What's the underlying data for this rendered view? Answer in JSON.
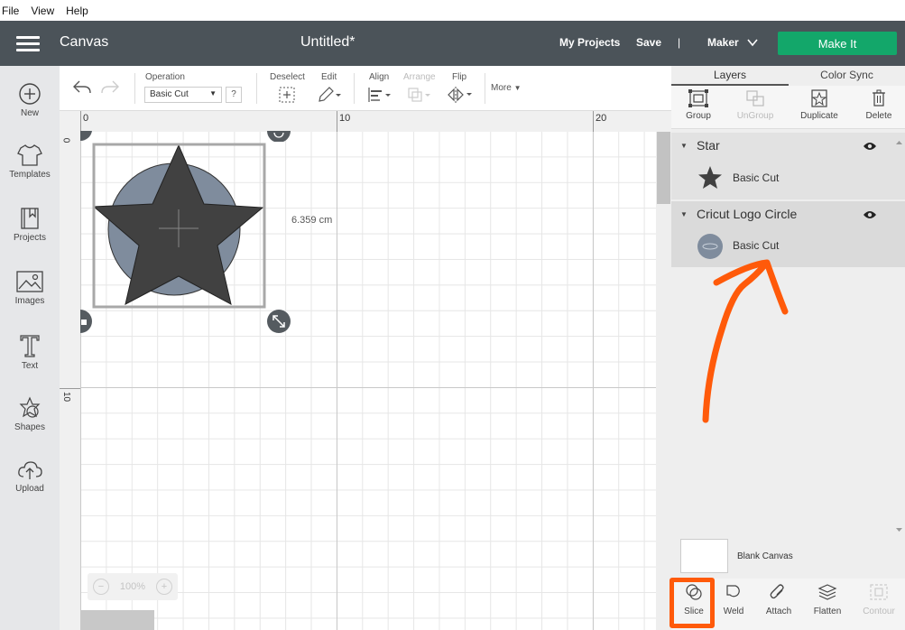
{
  "menu": [
    "File",
    "View",
    "Help"
  ],
  "header": {
    "app_title": "Canvas",
    "document_title": "Untitled*",
    "my_projects": "My Projects",
    "save": "Save",
    "separator": "|",
    "machine": "Maker",
    "make_it": "Make It"
  },
  "sidebar": {
    "items": [
      {
        "label": "New",
        "icon": "plus-circle-icon"
      },
      {
        "label": "Templates",
        "icon": "shirt-icon"
      },
      {
        "label": "Projects",
        "icon": "bookmark-icon"
      },
      {
        "label": "Images",
        "icon": "image-icon"
      },
      {
        "label": "Text",
        "icon": "text-icon"
      },
      {
        "label": "Shapes",
        "icon": "shapes-icon"
      },
      {
        "label": "Upload",
        "icon": "upload-icon"
      }
    ]
  },
  "toolbar": {
    "operation_label": "Operation",
    "operation_value": "Basic Cut",
    "help": "?",
    "deselect": "Deselect",
    "edit": "Edit",
    "align": "Align",
    "arrange": "Arrange",
    "flip": "Flip",
    "more": "More"
  },
  "canvas": {
    "ruler_top": [
      "0",
      "10",
      "20"
    ],
    "ruler_left": [
      "0",
      "10"
    ],
    "dimension": "6.359 cm",
    "zoom": "100%",
    "zoom_minus": "−",
    "zoom_plus": "+"
  },
  "right_panel": {
    "tabs": [
      "Layers",
      "Color Sync"
    ],
    "actions": [
      "Group",
      "UnGroup",
      "Duplicate",
      "Delete"
    ],
    "layers": [
      {
        "name": "Star",
        "item": "Basic Cut"
      },
      {
        "name": "Cricut Logo Circle",
        "item": "Basic Cut"
      }
    ],
    "blank_canvas": "Blank Canvas",
    "bottom_actions": [
      "Slice",
      "Weld",
      "Attach",
      "Flatten",
      "Contour"
    ]
  },
  "colors": {
    "header_bg": "#4b5359",
    "make_it": "#13a76a",
    "annotation": "#ff5a0a",
    "star": "#414141",
    "circle": "#7f8c9d"
  }
}
